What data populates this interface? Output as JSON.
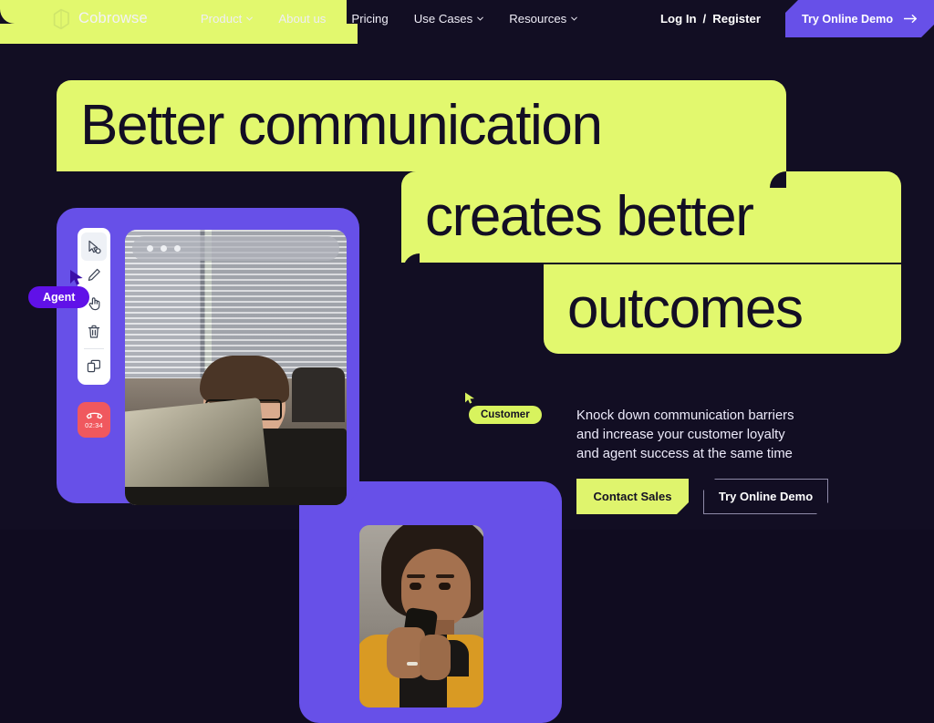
{
  "brand": {
    "name": "Cobrowse",
    "logo_icon": "cobrowse-logo-icon"
  },
  "nav": {
    "links": [
      {
        "label": "Product",
        "has_chevron": true
      },
      {
        "label": "About us",
        "has_chevron": false
      },
      {
        "label": "Pricing",
        "has_chevron": false
      },
      {
        "label": "Use Cases",
        "has_chevron": true
      },
      {
        "label": "Resources",
        "has_chevron": true
      }
    ],
    "login_label": "Log In",
    "separator": "/",
    "register_label": "Register",
    "demo_button": {
      "label": "Try Online Demo",
      "icon": "arrow-right-icon"
    }
  },
  "hero": {
    "line1": "Better communication",
    "line2": "creates better",
    "line3": "outcomes",
    "paragraph_lines": [
      "Knock down communication barriers",
      "and increase your customer loyalty",
      "and agent success at the same time"
    ],
    "cta_primary": "Contact Sales",
    "cta_secondary": "Try Online Demo"
  },
  "session": {
    "agent_badge": "Agent",
    "customer_badge": "Customer",
    "call_timer": "02:34",
    "tools": [
      {
        "name": "cursor-select-icon",
        "active": true
      },
      {
        "name": "pen-draw-icon",
        "active": false
      },
      {
        "name": "hand-pointer-icon",
        "active": false
      },
      {
        "name": "trash-delete-icon",
        "active": false
      },
      {
        "name": "screen-share-icon",
        "active": false
      }
    ],
    "end_call_icon": "hangup-phone-icon",
    "browser_dots": 3
  },
  "colors": {
    "background": "#120e23",
    "lime": "#e2f86e",
    "purple": "#6750e8",
    "badge_purple": "#6011e8",
    "red": "#f0585e",
    "text": "#ffffff"
  }
}
